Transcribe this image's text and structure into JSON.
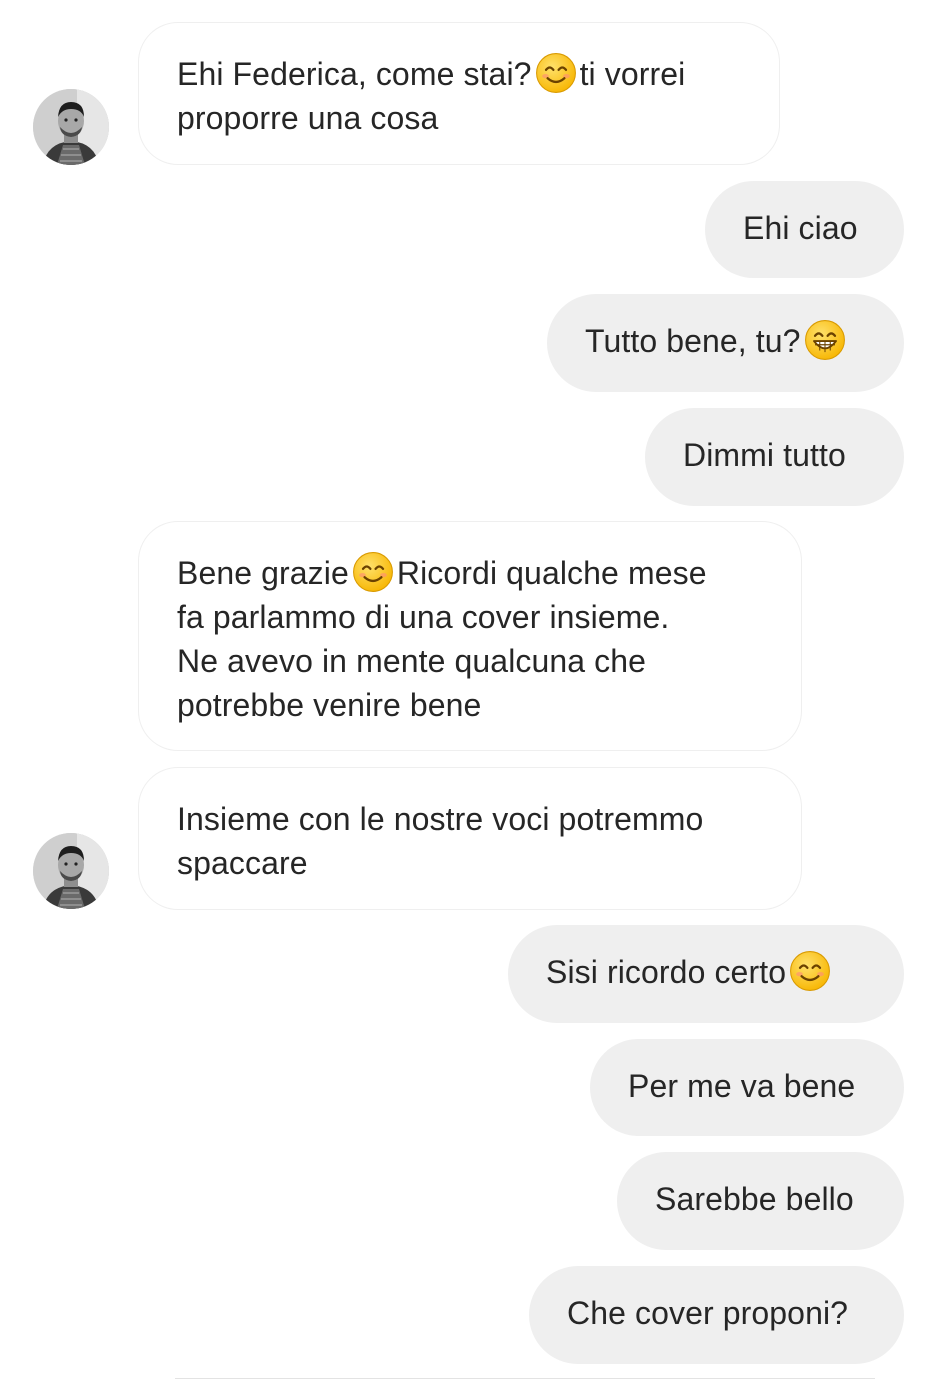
{
  "conversation": {
    "messages": [
      {
        "from": "them",
        "parts": [
          "Ehi Federica, come stai?",
          "smiling-eyes-emoji",
          "ti vorrei",
          "proporre una cosa"
        ]
      },
      {
        "from": "me",
        "text": "Ehi ciao"
      },
      {
        "from": "me",
        "text": "Tutto bene, tu?",
        "emoji": "grinning-emoji"
      },
      {
        "from": "me",
        "text": "Dimmi tutto"
      },
      {
        "from": "them",
        "lines": [
          "Bene grazie",
          "Ricordi qualche mese",
          "fa parlammo di una cover insieme.",
          "Ne avevo in mente qualcuna che",
          "potrebbe venire bene"
        ],
        "emoji": "smiling-eyes-emoji"
      },
      {
        "from": "them",
        "lines": [
          "Insieme con le nostre voci potremmo",
          "spaccare"
        ]
      },
      {
        "from": "me",
        "text": "Sisi ricordo certo",
        "emoji": "smiling-eyes-emoji"
      },
      {
        "from": "me",
        "text": "Per me va bene"
      },
      {
        "from": "me",
        "text": "Sarebbe bello"
      },
      {
        "from": "me",
        "text": "Che cover proponi?"
      }
    ]
  },
  "colors": {
    "incoming_bubble_bg": "#ffffff",
    "incoming_bubble_border": "#efefef",
    "outgoing_bubble_bg": "#efefef",
    "text": "#262626",
    "emoji_face": "#ffc83d"
  }
}
